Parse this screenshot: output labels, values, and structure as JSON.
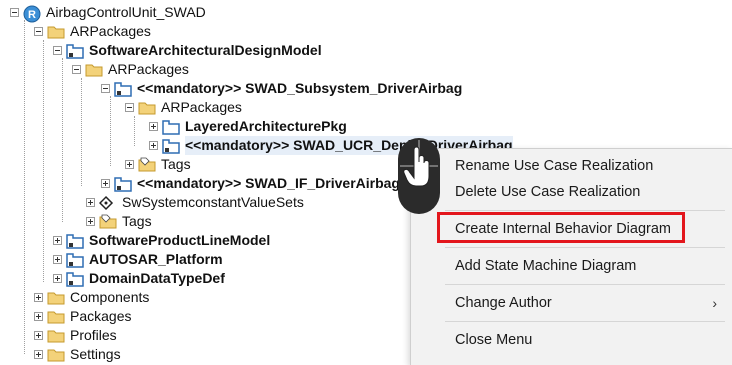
{
  "tree": {
    "root": {
      "label": "AirbagControlUnit_SWAD"
    },
    "items": [
      {
        "label": "ARPackages"
      },
      {
        "label": "SoftwareArchitecturalDesignModel"
      },
      {
        "label": "ARPackages"
      },
      {
        "label": "<<mandatory>> SWAD_Subsystem_DriverAirbag"
      },
      {
        "label": "ARPackages"
      },
      {
        "label": "LayeredArchitecturePkg"
      },
      {
        "label": "<<mandatory>> SWAD_UCR_DeployDriverAirbag"
      },
      {
        "label": "Tags"
      },
      {
        "label": "<<mandatory>> SWAD_IF_DriverAirbag"
      },
      {
        "label": "SwSystemconstantValueSets"
      },
      {
        "label": "Tags"
      },
      {
        "label": "SoftwareProductLineModel"
      },
      {
        "label": "AUTOSAR_Platform"
      },
      {
        "label": "DomainDataTypeDef"
      },
      {
        "label": "Components"
      },
      {
        "label": "Packages"
      },
      {
        "label": "Profiles"
      },
      {
        "label": "Settings"
      }
    ]
  },
  "context_menu": {
    "items": [
      {
        "label": "Rename Use Case Realization"
      },
      {
        "label": "Delete Use Case Realization"
      },
      {
        "label": "Create Internal Behavior Diagram"
      },
      {
        "label": "Add State Machine Diagram"
      },
      {
        "label": "Change Author",
        "submenu_indicator": "›"
      },
      {
        "label": "Close Menu"
      }
    ],
    "highlighted_item": "Create Internal Behavior Diagram",
    "highlight_color": "#e3161c"
  },
  "icons": {
    "root": "project-r-icon",
    "folder": "folder-icon",
    "package": "package-icon",
    "tags": "tags-folder-icon",
    "constant": "diamond-constant-icon",
    "cursor": "mouse-click-icon"
  },
  "colors": {
    "folder": "#e9c46a",
    "package_border": "#2f6db3",
    "menu_background": "#f2f2f2"
  }
}
